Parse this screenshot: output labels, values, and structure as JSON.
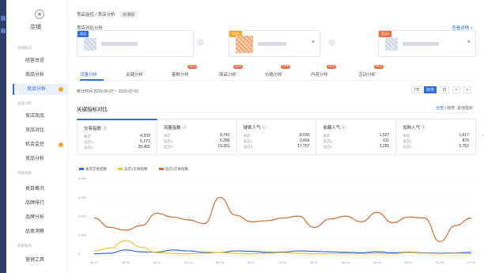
{
  "sidebar": {
    "brand": "店铺",
    "groups": [
      "商铺概况",
      "竞品分析",
      "市场洞察",
      "商家服务"
    ],
    "items": [
      {
        "label": "经营总览",
        "active": false
      },
      {
        "label": "商品分析",
        "active": false
      },
      {
        "label": "竞品分析",
        "active": true,
        "dot": true
      },
      {
        "label": "竞店商品",
        "active": false
      },
      {
        "label": "竞品对比",
        "active": false
      },
      {
        "label": "机会监控",
        "active": false,
        "dot": true
      },
      {
        "label": "竞品分析",
        "active": false
      },
      {
        "label": "类目概况",
        "active": false
      },
      {
        "label": "品牌排行",
        "active": false
      },
      {
        "label": "品牌分析",
        "active": false
      },
      {
        "label": "品类洞察",
        "active": false
      },
      {
        "label": "营销工具",
        "active": false
      }
    ]
  },
  "header": {
    "breadcrumb": "竞品监控 / 竞店分析",
    "tag": "标准版"
  },
  "compare": {
    "title": "竞店对比分析",
    "link": "查看详情 >",
    "cards": [
      {
        "tag": "本店",
        "tag_color": "#2f6de6"
      },
      {
        "tag": "竞店1",
        "tag_color": "#f5a623"
      },
      {
        "tag": "竞店2",
        "tag_color": "#f36b3c"
      }
    ],
    "close_glyph": "×"
  },
  "tabs": [
    {
      "label": "流量分析",
      "active": true,
      "badge": ""
    },
    {
      "label": "关键分析",
      "active": false,
      "badge": ""
    },
    {
      "label": "客群分析",
      "active": false,
      "badge": "NEW"
    },
    {
      "label": "商品分析",
      "active": false,
      "badge": "NEW"
    },
    {
      "label": "价格分析",
      "active": false,
      "badge": "NEW"
    },
    {
      "label": "内容分析",
      "active": false,
      "badge": "NEW"
    },
    {
      "label": "活动分析",
      "active": false,
      "badge": "NEW"
    }
  ],
  "date": {
    "range": "统计时间 2023-06-07 ~ 2023-07-01",
    "segments": [
      {
        "label": "7天",
        "active": false
      },
      {
        "label": "30天",
        "active": true
      },
      {
        "label": "日",
        "active": false
      },
      {
        "label": "<",
        "active": false
      },
      {
        "label": ">",
        "active": false
      }
    ]
  },
  "section": {
    "title": "关键指标对比",
    "ctrl_all": "全部",
    "ctrl_sep": "|",
    "ctrl_mid": "趋势",
    "ctrl_right": "其他指标"
  },
  "metrics": [
    {
      "title": "交易指数 ⓘ",
      "rows": [
        [
          "本店",
          "4,509"
        ],
        [
          "竞店1",
          "5,273"
        ],
        [
          "竞店2",
          "28,482"
        ]
      ]
    },
    {
      "title": "流量指数 ⓘ",
      "rows": [
        [
          "本店",
          "8,741"
        ],
        [
          "竞店1",
          "5,289"
        ],
        [
          "竞店2",
          "19,281"
        ]
      ]
    },
    {
      "title": "搜索人气 ⓘ",
      "rows": [
        [
          "本店",
          "8,090"
        ],
        [
          "竞店1",
          "3,469"
        ],
        [
          "竞店2",
          "17,757"
        ]
      ]
    },
    {
      "title": "收藏人气 ⓘ",
      "rows": [
        [
          "本店",
          "1,527"
        ],
        [
          "竞店1",
          "611"
        ],
        [
          "竞店2",
          "3,265"
        ]
      ]
    },
    {
      "title": "加购人气 ⓘ",
      "rows": [
        [
          "本店",
          "1,617"
        ],
        [
          "竞店1",
          "876"
        ],
        [
          "竞店2",
          "5,762"
        ]
      ]
    }
  ],
  "chart_data": {
    "type": "line",
    "x": [
      "06-07",
      "06-08",
      "06-09",
      "06-10",
      "06-11",
      "06-12",
      "06-13",
      "06-14",
      "06-15",
      "06-16",
      "06-17",
      "06-18",
      "06-19",
      "06-20",
      "06-21",
      "06-22",
      "06-23",
      "06-24",
      "06-25",
      "06-26",
      "06-27",
      "06-28",
      "06-29",
      "06-30",
      "07-01"
    ],
    "x_ticks": [
      "06-07",
      "06-08",
      "06-09",
      "06-10",
      "06-11",
      "06-12",
      "06-13",
      "06-14",
      "06-15",
      "06-16",
      "06-17",
      "06-18",
      "06-19",
      "06-20",
      "06-21",
      "06-22",
      "06-23",
      "06-24",
      "06-25",
      "06-26",
      "06-27",
      "06-28",
      "06-29",
      "06-30",
      "07-01"
    ],
    "y_ticks": [
      "0",
      "2,000",
      "4,000",
      "6,000",
      "8,000"
    ],
    "ylim": [
      0,
      8000
    ],
    "series": [
      {
        "name": "本店交易指数",
        "color": "#2f6de6",
        "values": [
          200,
          250,
          600,
          400,
          350,
          600,
          500,
          350,
          300,
          500,
          450,
          350,
          350,
          500,
          450,
          400,
          350,
          300,
          400,
          300,
          350,
          300,
          250,
          300,
          350
        ]
      },
      {
        "name": "竞店1交易指数",
        "color": "#f2c230",
        "values": [
          500,
          800,
          1600,
          900,
          300,
          250,
          200,
          250,
          300,
          250,
          200,
          250,
          300,
          250,
          200,
          200,
          250,
          200,
          250,
          200,
          300,
          250,
          200,
          250,
          200
        ]
      },
      {
        "name": "竞店2交易指数",
        "color": "#d9692b",
        "values": [
          4000,
          3000,
          2700,
          3200,
          4500,
          4100,
          3800,
          3400,
          6200,
          4300,
          3600,
          3700,
          4000,
          4200,
          3000,
          3900,
          4200,
          3600,
          4600,
          3500,
          4100,
          4000,
          1500,
          3200,
          4000
        ]
      }
    ]
  }
}
